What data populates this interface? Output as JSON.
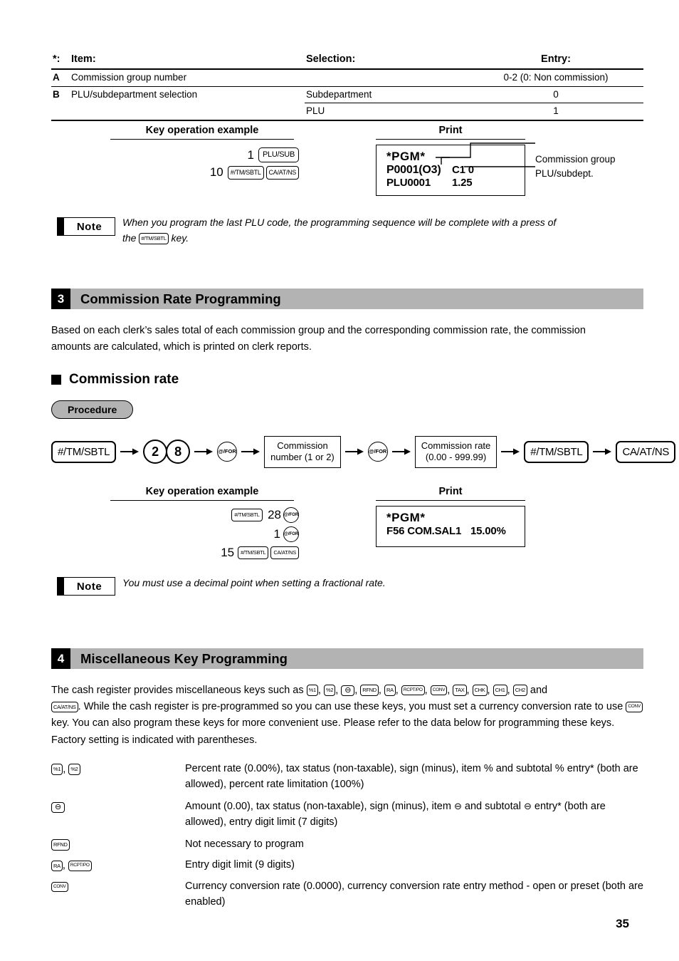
{
  "spec_table": {
    "headers": {
      "star": "*:",
      "item": "Item:",
      "selection": "Selection:",
      "entry": "Entry:"
    },
    "rows": [
      {
        "letter": "A",
        "description": "Commission group number",
        "selection": "",
        "entry": "0-2 (0: Non commission)"
      },
      {
        "letter": "B",
        "description": "PLU/subdepartment selection",
        "selection": "Subdepartment",
        "entry": "0"
      },
      {
        "letter": "",
        "description": "",
        "selection": "PLU",
        "entry": "1"
      }
    ]
  },
  "example1": {
    "key_caption": "Key operation example",
    "print_caption": "Print",
    "keys_row1": {
      "number": "1",
      "key": "PLU/SUB"
    },
    "keys_row2": {
      "number": "10",
      "key1": "#/TM/SBTL",
      "key2": "CA/AT/NS"
    },
    "receipt": {
      "line1": "*PGM*",
      "line2_left": "P0001(O3)",
      "line2_right": "C1 0",
      "line3_left": "PLU0001",
      "line3_right": "1.25"
    },
    "callouts": {
      "top": "Commission group",
      "bottom": "PLU/subdept."
    }
  },
  "note1": {
    "label": "Note",
    "text_part1": "When you program the last PLU code, the programming sequence will be complete with a press of",
    "text_part2": "the",
    "key": "#/TM/SBTL",
    "text_part3": "key."
  },
  "section3": {
    "number": "3",
    "title": "Commission Rate Programming",
    "paragraph": "Based on each clerk’s sales total of each commission group and the corresponding commission rate, the commission amounts are calculated, which is printed on clerk reports.",
    "subheading": "Commission rate",
    "procedure_label": "Procedure",
    "flow": [
      {
        "type": "key",
        "label": "#/TM/SBTL"
      },
      {
        "type": "arrow",
        "label": ""
      },
      {
        "type": "digit",
        "label": "2"
      },
      {
        "type": "digit",
        "label": "8"
      },
      {
        "type": "arrow",
        "label": ""
      },
      {
        "type": "round",
        "label": "@/FOR"
      },
      {
        "type": "arrow",
        "label": ""
      },
      {
        "type": "box",
        "label": "Commission\nnumber (1 or 2)",
        "line1": "Commission",
        "line2": "number (1 or 2)"
      },
      {
        "type": "arrow",
        "label": ""
      },
      {
        "type": "round",
        "label": "@/FOR"
      },
      {
        "type": "arrow",
        "label": ""
      },
      {
        "type": "box",
        "label": "Commission rate\n(0.00 - 999.99)",
        "line1": "Commission rate",
        "line2": "(0.00 - 999.99)"
      },
      {
        "type": "arrow",
        "label": ""
      },
      {
        "type": "key",
        "label": "#/TM/SBTL"
      },
      {
        "type": "arrow",
        "label": ""
      },
      {
        "type": "key",
        "label": "CA/AT/NS"
      }
    ]
  },
  "example2": {
    "key_caption": "Key operation example",
    "print_caption": "Print",
    "row1": {
      "key1": "#/TM/SBTL",
      "number": "28",
      "key2": "@/FOR"
    },
    "row2": {
      "number": "1",
      "key": "@/FOR"
    },
    "row3": {
      "number": "15",
      "key1": "#/TM/SBTL",
      "key2": "CA/AT/NS"
    },
    "receipt": {
      "line1": "*PGM*",
      "line2_left": "F56 COM.SAL1",
      "line2_right": "15.00%"
    }
  },
  "note2": {
    "label": "Note",
    "text": "You must use a decimal point when setting a fractional rate."
  },
  "section4": {
    "number": "4",
    "title": "Miscellaneous Key Programming",
    "intro_part1": "The cash register provides miscellaneous keys such as",
    "intro_keys": [
      "%1",
      "%2",
      "⊖",
      "RFND",
      "RA",
      "RCPT/PO",
      "CONV",
      "TAX",
      "CHK",
      "CH1",
      "CH2"
    ],
    "intro_part2": "and",
    "intro_part3": ".  While the cash register is pre-programmed so you can use these keys, you must set a currency conversion rate to use",
    "intro_key_ca": "CA/AT/NS",
    "intro_key_conv": "CONV",
    "intro_part4": "key.  You can also program these keys for more convenient use.  Please refer to the data below for programming these keys. Factory setting is indicated with parentheses.",
    "definitions": [
      {
        "keys": [
          "%1",
          "%2"
        ],
        "desc": "Percent rate (0.00%), tax status (non-taxable), sign (minus), item % and subtotal % entry* (both are allowed), percent rate limitation (100%)"
      },
      {
        "keys": [
          "⊖"
        ],
        "desc_part1": "Amount (0.00), tax status (non-taxable), sign (minus), item",
        "desc_part2": "and subtotal",
        "desc_part3": "entry* (both are allowed), entry digit limit (7 digits)"
      },
      {
        "keys": [
          "RFND"
        ],
        "desc": "Not necessary to program"
      },
      {
        "keys": [
          "RA",
          "RCPT/PO"
        ],
        "desc": "Entry digit limit (9 digits)"
      },
      {
        "keys": [
          "CONV"
        ],
        "desc": "Currency conversion rate (0.0000), currency conversion rate entry method - open or preset (both are enabled)"
      }
    ]
  },
  "page_number": "35",
  "colors": {
    "section_bar": "#b3b3b3",
    "section_num": "#000000",
    "text": "#000000"
  }
}
